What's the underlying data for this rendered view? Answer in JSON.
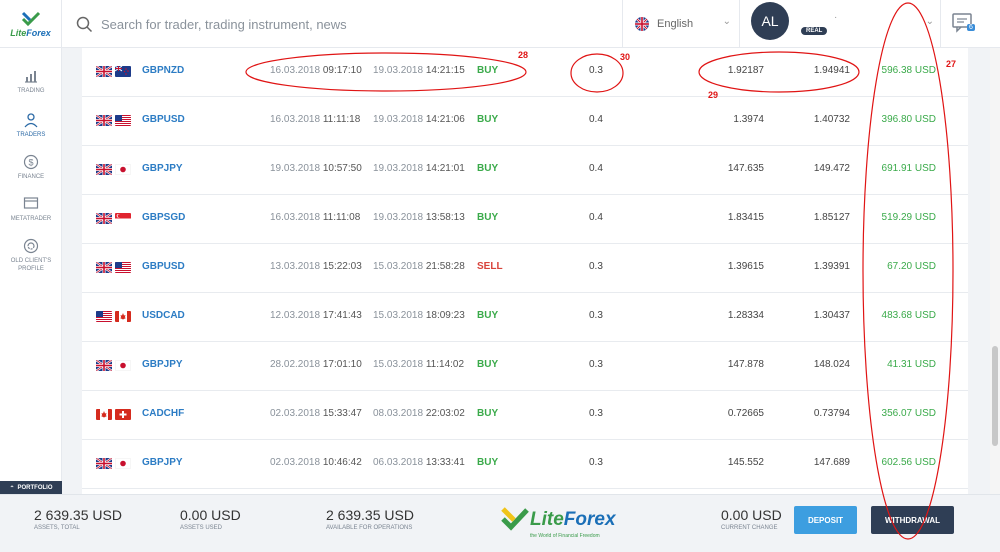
{
  "header": {
    "logo": "LiteForex",
    "search_placeholder": "Search for trader, trading instrument, news",
    "language": "English",
    "avatar_initials": "AL",
    "account_badge": "REAL",
    "user_name": "·",
    "notifications_count": "6"
  },
  "sidebar": {
    "items": [
      {
        "label": "TRADING",
        "icon": "chart-bars-icon"
      },
      {
        "label": "TRADERS",
        "icon": "traders-icon"
      },
      {
        "label": "FINANCE",
        "icon": "dollar-icon"
      },
      {
        "label": "METATRADER",
        "icon": "monitor-icon"
      },
      {
        "label": "OLD CLIENT'S PROFILE",
        "icon": "refresh-icon"
      }
    ],
    "portfolio_tab": "PORTFOLIO"
  },
  "trades": [
    {
      "f1": "GB",
      "f2": "NZ",
      "instrument": "GBPNZD",
      "open_date": "16.03.2018",
      "open_time": "09:17:10",
      "close_date": "19.03.2018",
      "close_time": "14:21:15",
      "direction": "BUY",
      "volume": "0.3",
      "open_price": "1.92187",
      "close_price": "1.94941",
      "profit": "596.38 USD"
    },
    {
      "f1": "GB",
      "f2": "US",
      "instrument": "GBPUSD",
      "open_date": "16.03.2018",
      "open_time": "11:11:18",
      "close_date": "19.03.2018",
      "close_time": "14:21:06",
      "direction": "BUY",
      "volume": "0.4",
      "open_price": "1.3974",
      "close_price": "1.40732",
      "profit": "396.80 USD"
    },
    {
      "f1": "GB",
      "f2": "JP",
      "instrument": "GBPJPY",
      "open_date": "19.03.2018",
      "open_time": "10:57:50",
      "close_date": "19.03.2018",
      "close_time": "14:21:01",
      "direction": "BUY",
      "volume": "0.4",
      "open_price": "147.635",
      "close_price": "149.472",
      "profit": "691.91 USD"
    },
    {
      "f1": "GB",
      "f2": "SG",
      "instrument": "GBPSGD",
      "open_date": "16.03.2018",
      "open_time": "11:11:08",
      "close_date": "19.03.2018",
      "close_time": "13:58:13",
      "direction": "BUY",
      "volume": "0.4",
      "open_price": "1.83415",
      "close_price": "1.85127",
      "profit": "519.29 USD"
    },
    {
      "f1": "GB",
      "f2": "US",
      "instrument": "GBPUSD",
      "open_date": "13.03.2018",
      "open_time": "15:22:03",
      "close_date": "15.03.2018",
      "close_time": "21:58:28",
      "direction": "SELL",
      "volume": "0.3",
      "open_price": "1.39615",
      "close_price": "1.39391",
      "profit": "67.20 USD"
    },
    {
      "f1": "US",
      "f2": "CA",
      "instrument": "USDCAD",
      "open_date": "12.03.2018",
      "open_time": "17:41:43",
      "close_date": "15.03.2018",
      "close_time": "18:09:23",
      "direction": "BUY",
      "volume": "0.3",
      "open_price": "1.28334",
      "close_price": "1.30437",
      "profit": "483.68 USD"
    },
    {
      "f1": "GB",
      "f2": "JP",
      "instrument": "GBPJPY",
      "open_date": "28.02.2018",
      "open_time": "17:01:10",
      "close_date": "15.03.2018",
      "close_time": "11:14:02",
      "direction": "BUY",
      "volume": "0.3",
      "open_price": "147.878",
      "close_price": "148.024",
      "profit": "41.31 USD"
    },
    {
      "f1": "CA",
      "f2": "CH",
      "instrument": "CADCHF",
      "open_date": "02.03.2018",
      "open_time": "15:33:47",
      "close_date": "08.03.2018",
      "close_time": "22:03:02",
      "direction": "BUY",
      "volume": "0.3",
      "open_price": "0.72665",
      "close_price": "0.73794",
      "profit": "356.07 USD"
    },
    {
      "f1": "GB",
      "f2": "JP",
      "instrument": "GBPJPY",
      "open_date": "02.03.2018",
      "open_time": "10:46:42",
      "close_date": "06.03.2018",
      "close_time": "13:33:41",
      "direction": "BUY",
      "volume": "0.3",
      "open_price": "145.552",
      "close_price": "147.689",
      "profit": "602.56 USD"
    }
  ],
  "footer": {
    "assets_total": {
      "value": "2 639.35 USD",
      "label": "ASSETS, TOTAL"
    },
    "assets_used": {
      "value": "0.00 USD",
      "label": "ASSETS USED"
    },
    "available": {
      "value": "2 639.35 USD",
      "label": "AVAILABLE FOR OPERATIONS"
    },
    "current_change": {
      "value": "0.00 USD",
      "label": "CURRENT CHANGE"
    },
    "logo": "LiteForex",
    "logo_tagline": "the World of Financial Freedom",
    "deposit_label": "DEPOSIT",
    "withdrawal_label": "WITHDRAWAL"
  },
  "annotations": [
    "28",
    "30",
    "29",
    "27"
  ],
  "colors": {
    "accent_blue": "#2c7cc4",
    "buy_green": "#3aaa4a",
    "sell_red": "#d8433b",
    "annotation_red": "#e01414",
    "dark_navy": "#2f3e55"
  }
}
